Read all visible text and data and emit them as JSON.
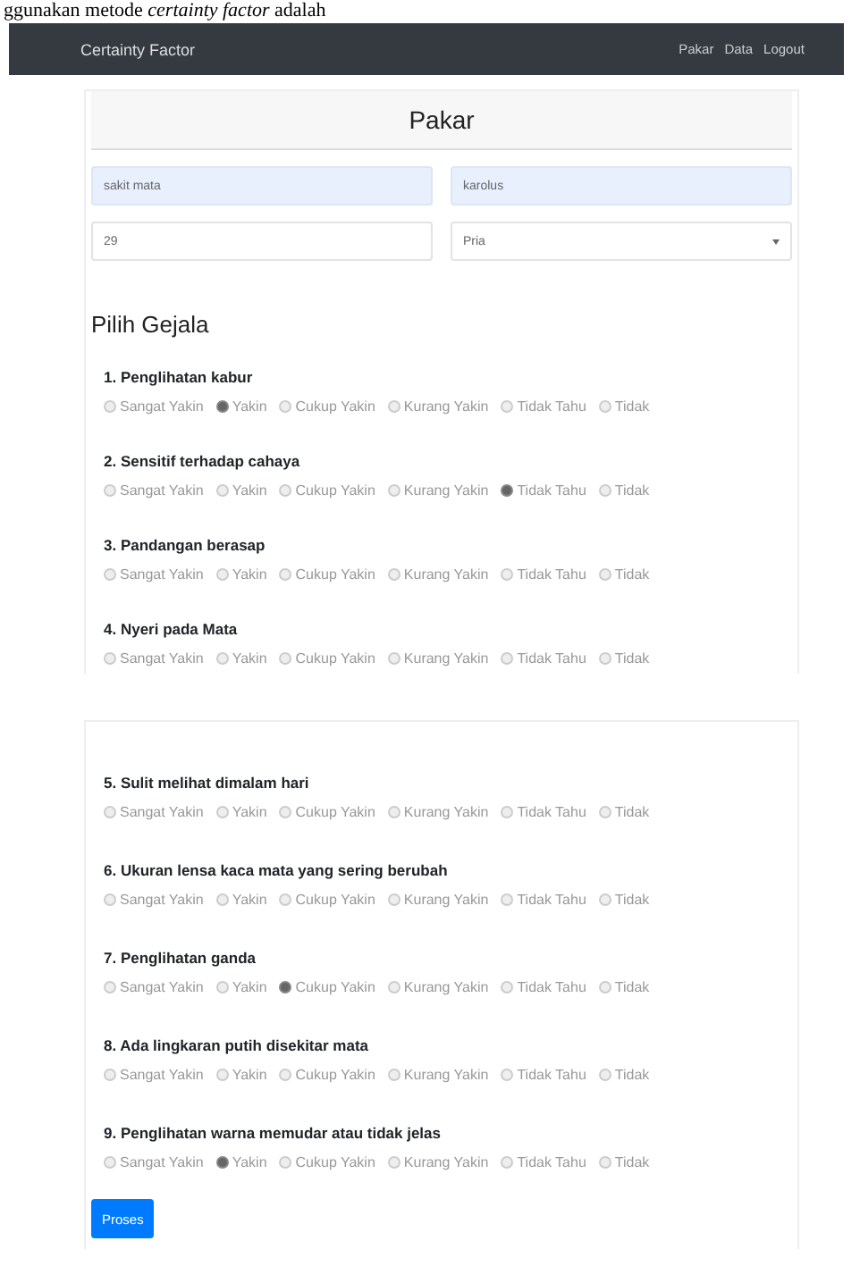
{
  "document_text": "ggunakan metode *certainty factor* adalah",
  "navbar": {
    "brand": "Certainty Factor",
    "links": [
      "Pakar",
      "Data",
      "Logout"
    ]
  },
  "card": {
    "title": "Pakar",
    "fields": [
      {
        "kind": "input",
        "value": "sakit mata",
        "autofilled": true
      },
      {
        "kind": "input",
        "value": "karolus",
        "autofilled": true
      },
      {
        "kind": "input",
        "value": "29",
        "autofilled": false
      },
      {
        "kind": "select",
        "value": "Pria",
        "autofilled": false
      }
    ],
    "section_title": "Pilih Gejala"
  },
  "panels": [
    {
      "symptoms": [
        {
          "title": "1. Penglihatan kabur",
          "options": [
            {
              "label": "Sangat Yakin",
              "selected": false
            },
            {
              "label": "Yakin",
              "selected": true
            },
            {
              "label": "Cukup Yakin",
              "selected": false
            },
            {
              "label": "Kurang Yakin",
              "selected": false
            },
            {
              "label": "Tidak Tahu",
              "selected": false
            },
            {
              "label": "Tidak",
              "selected": false
            }
          ]
        },
        {
          "title": "2. Sensitif terhadap cahaya",
          "options": [
            {
              "label": "Sangat Yakin",
              "selected": false
            },
            {
              "label": "Yakin",
              "selected": false
            },
            {
              "label": "Cukup Yakin",
              "selected": false
            },
            {
              "label": "Kurang Yakin",
              "selected": false
            },
            {
              "label": "Tidak Tahu",
              "selected": true
            },
            {
              "label": "Tidak",
              "selected": false
            }
          ]
        },
        {
          "title": "3. Pandangan berasap",
          "options": [
            {
              "label": "Sangat Yakin",
              "selected": false
            },
            {
              "label": "Yakin",
              "selected": false
            },
            {
              "label": "Cukup Yakin",
              "selected": false
            },
            {
              "label": "Kurang Yakin",
              "selected": false
            },
            {
              "label": "Tidak Tahu",
              "selected": false
            },
            {
              "label": "Tidak",
              "selected": false
            }
          ]
        },
        {
          "title": "4. Nyeri pada Mata",
          "options": [
            {
              "label": "Sangat Yakin",
              "selected": false
            },
            {
              "label": "Yakin",
              "selected": false
            },
            {
              "label": "Cukup Yakin",
              "selected": false
            },
            {
              "label": "Kurang Yakin",
              "selected": false
            },
            {
              "label": "Tidak Tahu",
              "selected": false
            },
            {
              "label": "Tidak",
              "selected": false
            }
          ]
        }
      ]
    },
    {
      "symptoms": [
        {
          "title": "5. Sulit melihat dimalam hari",
          "options": [
            {
              "label": "Sangat Yakin",
              "selected": false
            },
            {
              "label": "Yakin",
              "selected": false
            },
            {
              "label": "Cukup Yakin",
              "selected": false
            },
            {
              "label": "Kurang Yakin",
              "selected": false
            },
            {
              "label": "Tidak Tahu",
              "selected": false
            },
            {
              "label": "Tidak",
              "selected": false
            }
          ]
        },
        {
          "title": "6. Ukuran lensa kaca mata yang sering berubah",
          "options": [
            {
              "label": "Sangat Yakin",
              "selected": false
            },
            {
              "label": "Yakin",
              "selected": false
            },
            {
              "label": "Cukup Yakin",
              "selected": false
            },
            {
              "label": "Kurang Yakin",
              "selected": false
            },
            {
              "label": "Tidak Tahu",
              "selected": false
            },
            {
              "label": "Tidak",
              "selected": false
            }
          ]
        },
        {
          "title": "7. Penglihatan ganda",
          "options": [
            {
              "label": "Sangat Yakin",
              "selected": false
            },
            {
              "label": "Yakin",
              "selected": false
            },
            {
              "label": "Cukup Yakin",
              "selected": true
            },
            {
              "label": "Kurang Yakin",
              "selected": false
            },
            {
              "label": "Tidak Tahu",
              "selected": false
            },
            {
              "label": "Tidak",
              "selected": false
            }
          ]
        },
        {
          "title": "8. Ada lingkaran putih disekitar mata",
          "options": [
            {
              "label": "Sangat Yakin",
              "selected": false
            },
            {
              "label": "Yakin",
              "selected": false
            },
            {
              "label": "Cukup Yakin",
              "selected": false
            },
            {
              "label": "Kurang Yakin",
              "selected": false
            },
            {
              "label": "Tidak Tahu",
              "selected": false
            },
            {
              "label": "Tidak",
              "selected": false
            }
          ]
        },
        {
          "title": "9. Penglihatan warna memudar atau tidak jelas",
          "options": [
            {
              "label": "Sangat Yakin",
              "selected": false
            },
            {
              "label": "Yakin",
              "selected": true
            },
            {
              "label": "Cukup Yakin",
              "selected": false
            },
            {
              "label": "Kurang Yakin",
              "selected": false
            },
            {
              "label": "Tidak Tahu",
              "selected": false
            },
            {
              "label": "Tidak",
              "selected": false
            }
          ]
        }
      ],
      "button": "Proses"
    }
  ]
}
